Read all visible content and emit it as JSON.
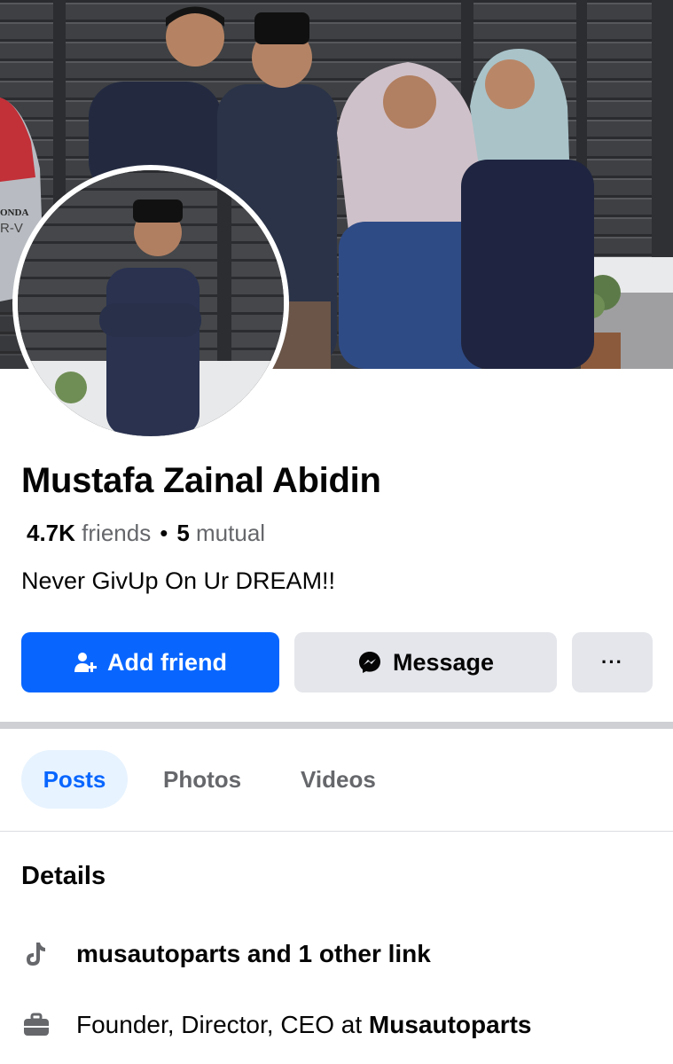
{
  "profile": {
    "name": "Mustafa Zainal Abidin",
    "friends_count": "4.7K",
    "friends_label": "friends",
    "separator": "•",
    "mutual_count": "5",
    "mutual_label": "mutual",
    "bio": "Never GivUp On Ur DREAM!!"
  },
  "cover": {
    "car_badge_line1": "ONDA",
    "car_badge_line2": "R-V"
  },
  "actions": {
    "add_friend_label": "Add friend",
    "message_label": "Message",
    "more_label": "···"
  },
  "tabs": [
    {
      "label": "Posts",
      "active": true
    },
    {
      "label": "Photos",
      "active": false
    },
    {
      "label": "Videos",
      "active": false
    }
  ],
  "details": {
    "title": "Details",
    "link_text": "musautoparts and 1 other link",
    "work_prefix": "Founder, Director, CEO at ",
    "work_company": "Musautoparts"
  },
  "icons": {
    "add_friend": "person-plus-icon",
    "message": "messenger-icon",
    "link": "tiktok-icon",
    "work": "briefcase-icon"
  },
  "colors": {
    "primary": "#0866ff",
    "secondary_button": "#e4e6eb",
    "active_tab_bg": "#e7f3ff",
    "muted_text": "#65676b"
  }
}
